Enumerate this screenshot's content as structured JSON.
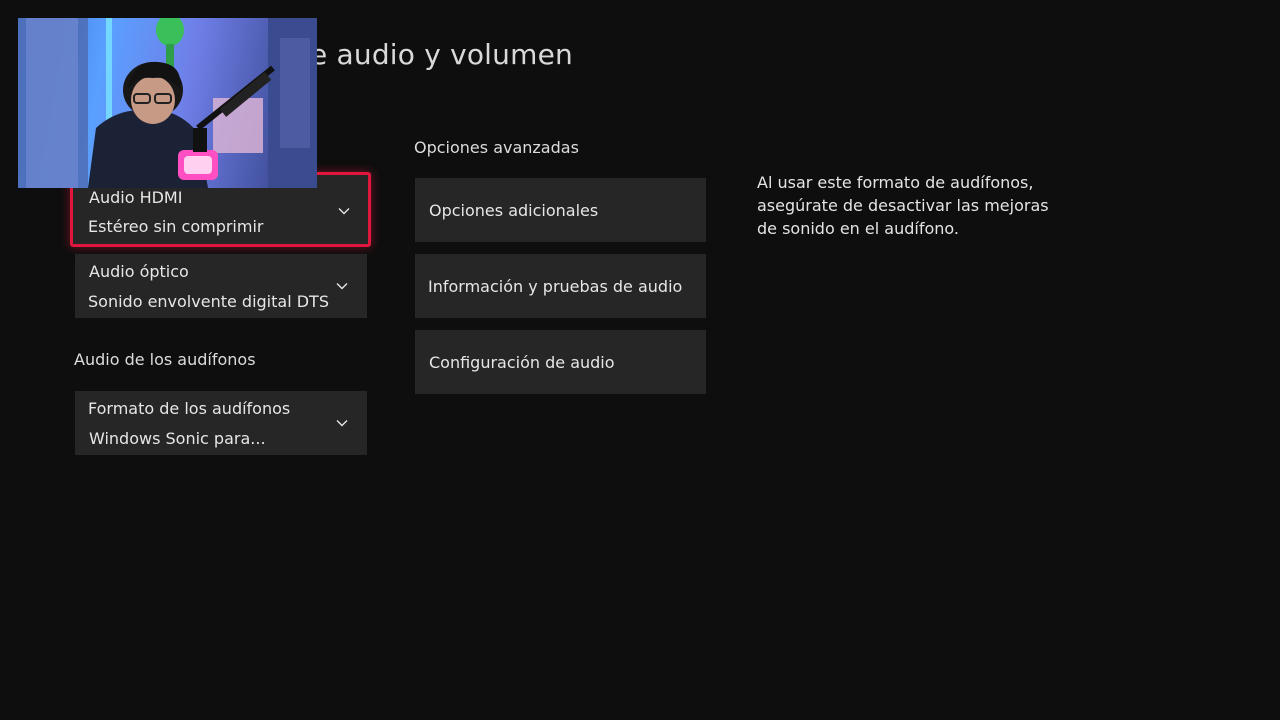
{
  "header": {
    "title": "e audio y volumen"
  },
  "left": {
    "hdmi": {
      "label": "Audio HDMI",
      "value": "Estéreo sin comprimir"
    },
    "optical": {
      "label": "Audio óptico",
      "value": "Sonido envolvente digital DTS"
    },
    "headset_section": "Audio de los audífonos",
    "headset_format": {
      "label": "Formato de los audífonos",
      "value": "Windows Sonic para..."
    }
  },
  "advanced": {
    "section": "Opciones avanzadas",
    "buttons": [
      "Opciones adicionales",
      "Información y pruebas de audio",
      "Configuración de audio"
    ]
  },
  "help_text": "Al usar este formato de audífonos, asegúrate de desactivar las mejoras de sonido en el audífono.",
  "webcam": {
    "icon": "webcam-overlay"
  },
  "colors": {
    "background": "#0e0e0e",
    "tile": "#262626",
    "focus": "#e0173d"
  }
}
